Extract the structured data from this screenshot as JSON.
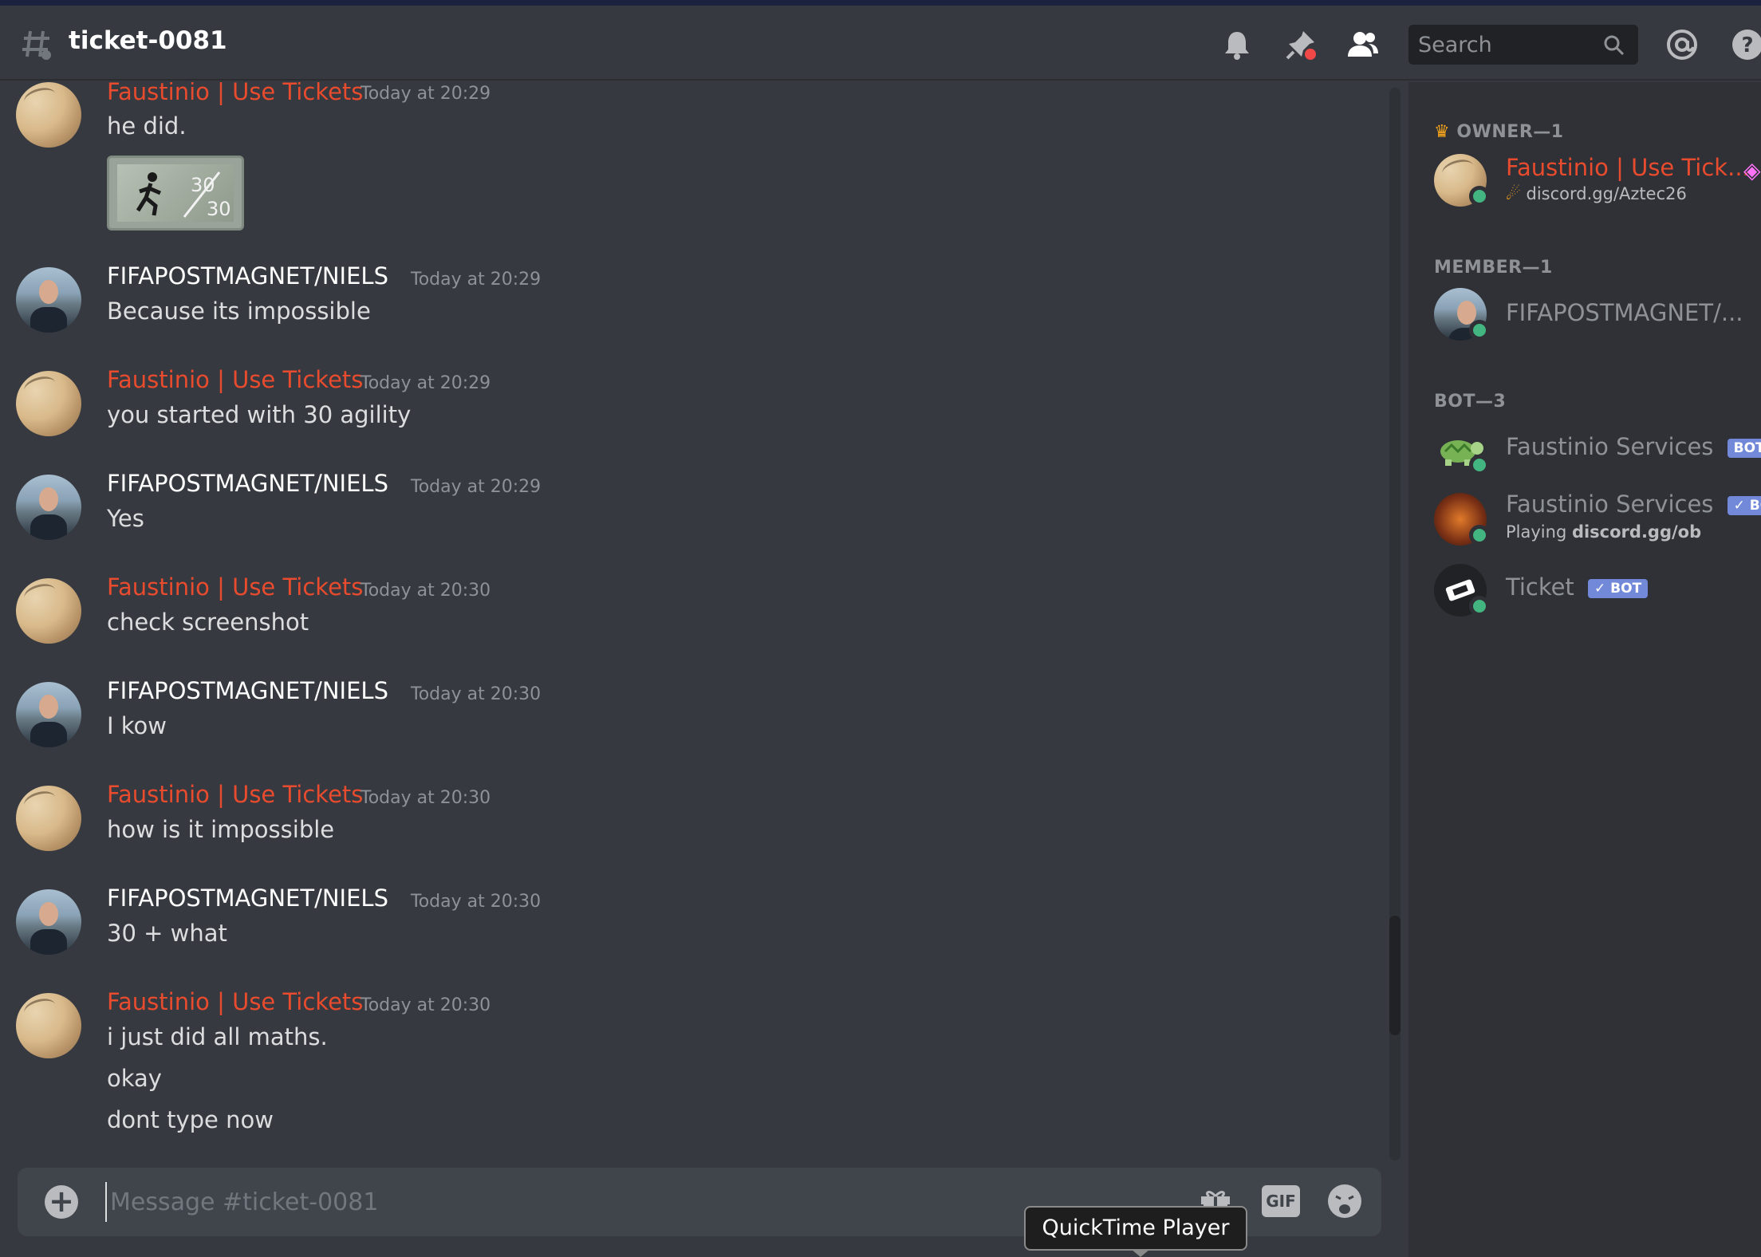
{
  "window": {
    "channel": "ticket-0081"
  },
  "header": {
    "search_placeholder": "Search",
    "icons": [
      "hash-icon",
      "bell-icon",
      "pin-icon",
      "members-icon",
      "search-icon",
      "mention-icon",
      "help-icon"
    ]
  },
  "messages": [
    {
      "author": "Faustinio | Use Tickets",
      "timestamp": "Today at 20:29",
      "lines": [
        "he did."
      ],
      "attachment": "30/30 agility image"
    },
    {
      "author": "FIFAPOSTMAGNET/NIELS",
      "timestamp": "Today at 20:29",
      "lines": [
        "Because its impossible"
      ]
    },
    {
      "author": "Faustinio | Use Tickets",
      "timestamp": "Today at 20:29",
      "lines": [
        "you started with 30 agility"
      ]
    },
    {
      "author": "FIFAPOSTMAGNET/NIELS",
      "timestamp": "Today at 20:29",
      "lines": [
        "Yes"
      ]
    },
    {
      "author": "Faustinio | Use Tickets",
      "timestamp": "Today at 20:30",
      "lines": [
        "check screenshot"
      ]
    },
    {
      "author": "FIFAPOSTMAGNET/NIELS",
      "timestamp": "Today at 20:30",
      "lines": [
        "I kow"
      ]
    },
    {
      "author": "Faustinio | Use Tickets",
      "timestamp": "Today at 20:30",
      "lines": [
        "how is it impossible"
      ]
    },
    {
      "author": "FIFAPOSTMAGNET/NIELS",
      "timestamp": "Today at 20:30",
      "lines": [
        "30 + what"
      ]
    },
    {
      "author": "Faustinio | Use Tickets",
      "timestamp": "Today at 20:30",
      "lines": [
        "i just did all maths.",
        "okay",
        "dont type now"
      ]
    }
  ],
  "composer": {
    "placeholder": "Message #ticket-0081",
    "gif_label": "GIF"
  },
  "tooltip": "QuickTime Player",
  "members": {
    "owner_header": "OWNER—1",
    "owner": {
      "name": "Faustinio | Use Tick...",
      "status": "discord.gg/Aztec26"
    },
    "member_header": "MEMBER—1",
    "member": {
      "name": "FIFAPOSTMAGNET/..."
    },
    "bot_header": "BOT—3",
    "bots": [
      {
        "name": "Faustinio Services",
        "tag": "BOT"
      },
      {
        "name": "Faustinio Services",
        "tag": "✓ BOT",
        "status_prefix": "Playing ",
        "status": "discord.gg/ob"
      },
      {
        "name": "Ticket",
        "tag": "✓ BOT"
      }
    ]
  },
  "colors": {
    "owner_name": "#e84b2d",
    "online": "#43b581",
    "bot_tag": "#7289da",
    "background": "#36393f"
  }
}
